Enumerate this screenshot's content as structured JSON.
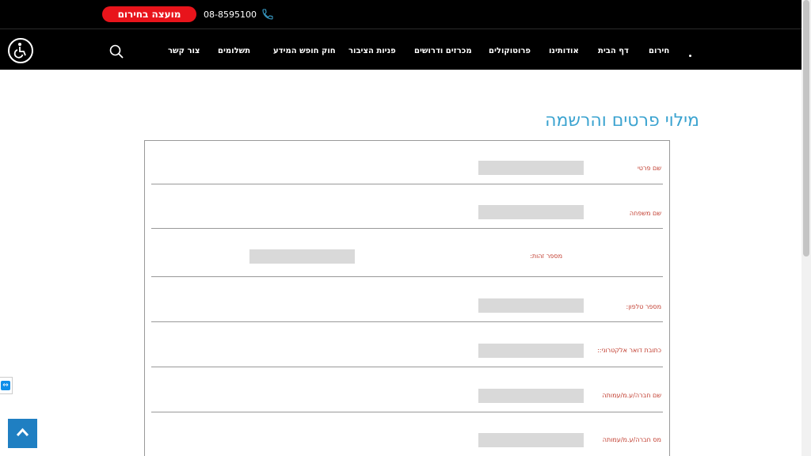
{
  "header": {
    "cta_label": "מועצה בחירום",
    "phone": "08-8595100"
  },
  "nav": {
    "items": [
      {
        "label": "חירום"
      },
      {
        "label": "דף הבית"
      },
      {
        "label": "אודותינו"
      },
      {
        "label": "פרוטוקולים"
      },
      {
        "label": "מכרזים ודרושים"
      },
      {
        "label": "פניות הציבור"
      },
      {
        "label": "חוק חופש המידע"
      },
      {
        "label": "תשלומים"
      },
      {
        "label": "צור קשר"
      }
    ]
  },
  "main": {
    "title": "מילוי פרטים והרשמה"
  },
  "form": {
    "fields": [
      {
        "label": "שם פרטי"
      },
      {
        "label": "שם משפחה"
      },
      {
        "label": "מספר זהות:"
      },
      {
        "label": "מספר טלפון:"
      },
      {
        "label": "כתובת דואר אלקטרוני::"
      },
      {
        "label": "שם חברה/ע.מ/עמותה"
      },
      {
        "label": "מס חברה/ע.מ/עמותה"
      }
    ]
  },
  "colors": {
    "topbar": "#000000",
    "cta": "#e8141b",
    "title": "#3ba3d0",
    "label": "#c0392b",
    "input": "#d9d9d9",
    "back_to_top": "#1f7fc2"
  }
}
